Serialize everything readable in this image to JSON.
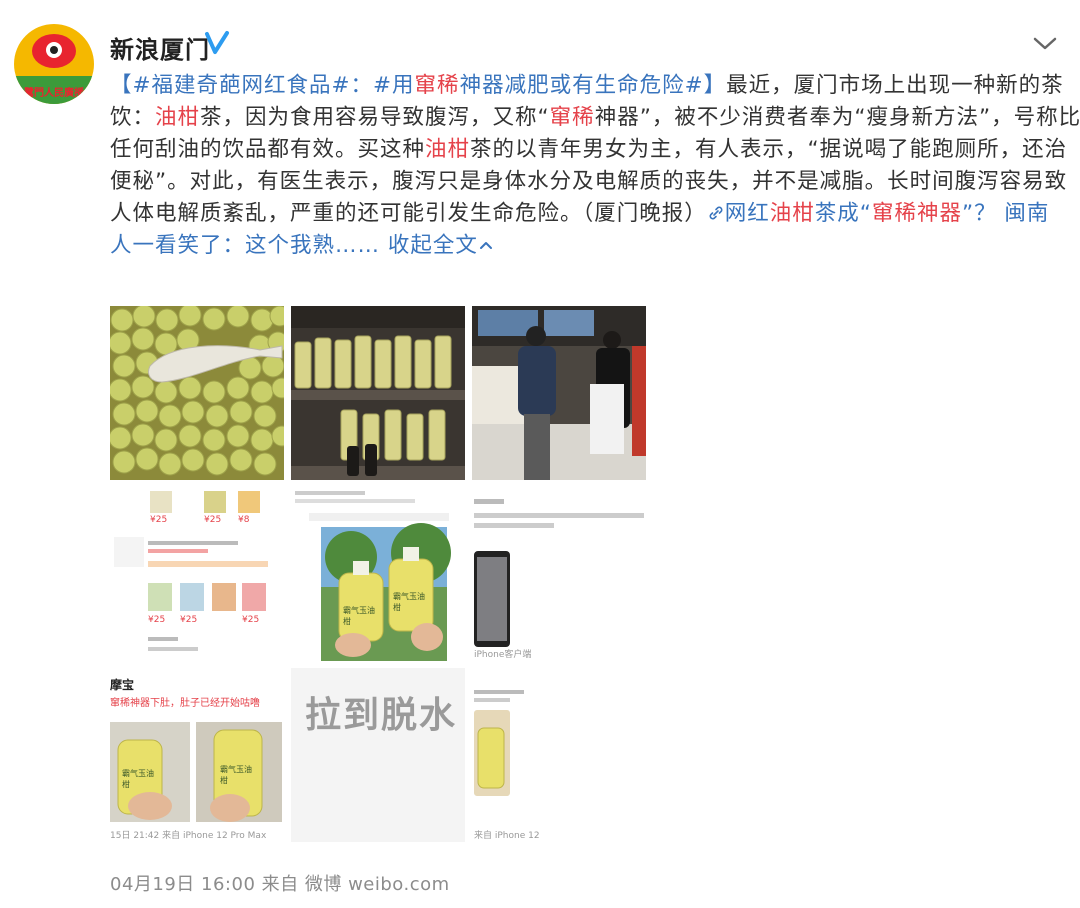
{
  "post": {
    "username": "新浪厦门",
    "avatar_label": "鷺門人民廣播",
    "verified_icon": "verified-v-icon",
    "menu_icon": "chevron-down-icon",
    "content": {
      "topic": "【#福建奇葩网红食品#：#用窜稀神器减肥或有生命危险#】",
      "l1_a": "【#福建奇葩网红食品#：#用",
      "l1_hl": "窜稀",
      "l1_b": "神器减肥或有生命危险#】",
      "l1_c": "最近，厦门市场上出现一种新的茶",
      "l2_a": "饮：",
      "l2_hl1": "油柑",
      "l2_b": "茶，因为食用容易导致腹泻，又称“",
      "l2_hl2": "窜稀",
      "l2_c": "神器”，被不少消费者奉为“瘦身新方法”，号称比",
      "l3_a": "任何刮油的饮品都有效。买这种",
      "l3_hl": "油柑",
      "l3_b": "茶的以青年男女为主，有人表示，“据说喝了能跑厕所，还治",
      "l4": "便秘”。对此，有医生表示，腹泻只是身体水分及电解质的丧失，并不是减脂。长时间腹泻容易致",
      "l5_a": "人体电解质紊乱，严重的还可能引发生命危险。（厦门晚报）",
      "l5_link_a": "网红",
      "l5_link_hl1": "油柑",
      "l5_link_b": "茶成“",
      "l5_link_hl2": "窜稀神器",
      "l5_link_c": "”？ 闽南",
      "l6_link": "人一看笑了：这个我熟……",
      "collapse": "收起全文",
      "collapse_icon": "chevron-up-icon",
      "link_icon": "link-icon"
    },
    "images": [
      {
        "name": "grid-image-youcan-fruit"
      },
      {
        "name": "grid-image-bottles-shelf"
      },
      {
        "name": "grid-image-shop-queue"
      },
      {
        "name": "grid-image-delivery-app",
        "prices": [
          "¥25",
          "¥25",
          "¥8",
          "¥25",
          "¥25",
          "¥25"
        ]
      },
      {
        "name": "grid-image-weibo-post-bottles",
        "bottle_text": "霸气玉油柑"
      },
      {
        "name": "grid-image-chat-screenshot",
        "device": "iPhone客户端"
      },
      {
        "name": "grid-image-comment-bottles",
        "header": "摩宝",
        "line": "窜稀神器下肚，肚子已经开始咕噜",
        "bottle_text": "霸气玉油柑",
        "time": "15日 21:42 来自 iPhone 12 Pro Max"
      },
      {
        "name": "grid-image-text-meme",
        "text": "拉到脱水"
      },
      {
        "name": "grid-image-small-screenshot",
        "device": "来自 iPhone 12"
      }
    ],
    "footer": "04月19日 16:00  来自 微博 weibo.com"
  },
  "colors": {
    "link": "#3974bd",
    "highlight": "#e5424a",
    "text": "#333333",
    "meta": "#8c8c8c",
    "verified": "#2d9cf0"
  }
}
